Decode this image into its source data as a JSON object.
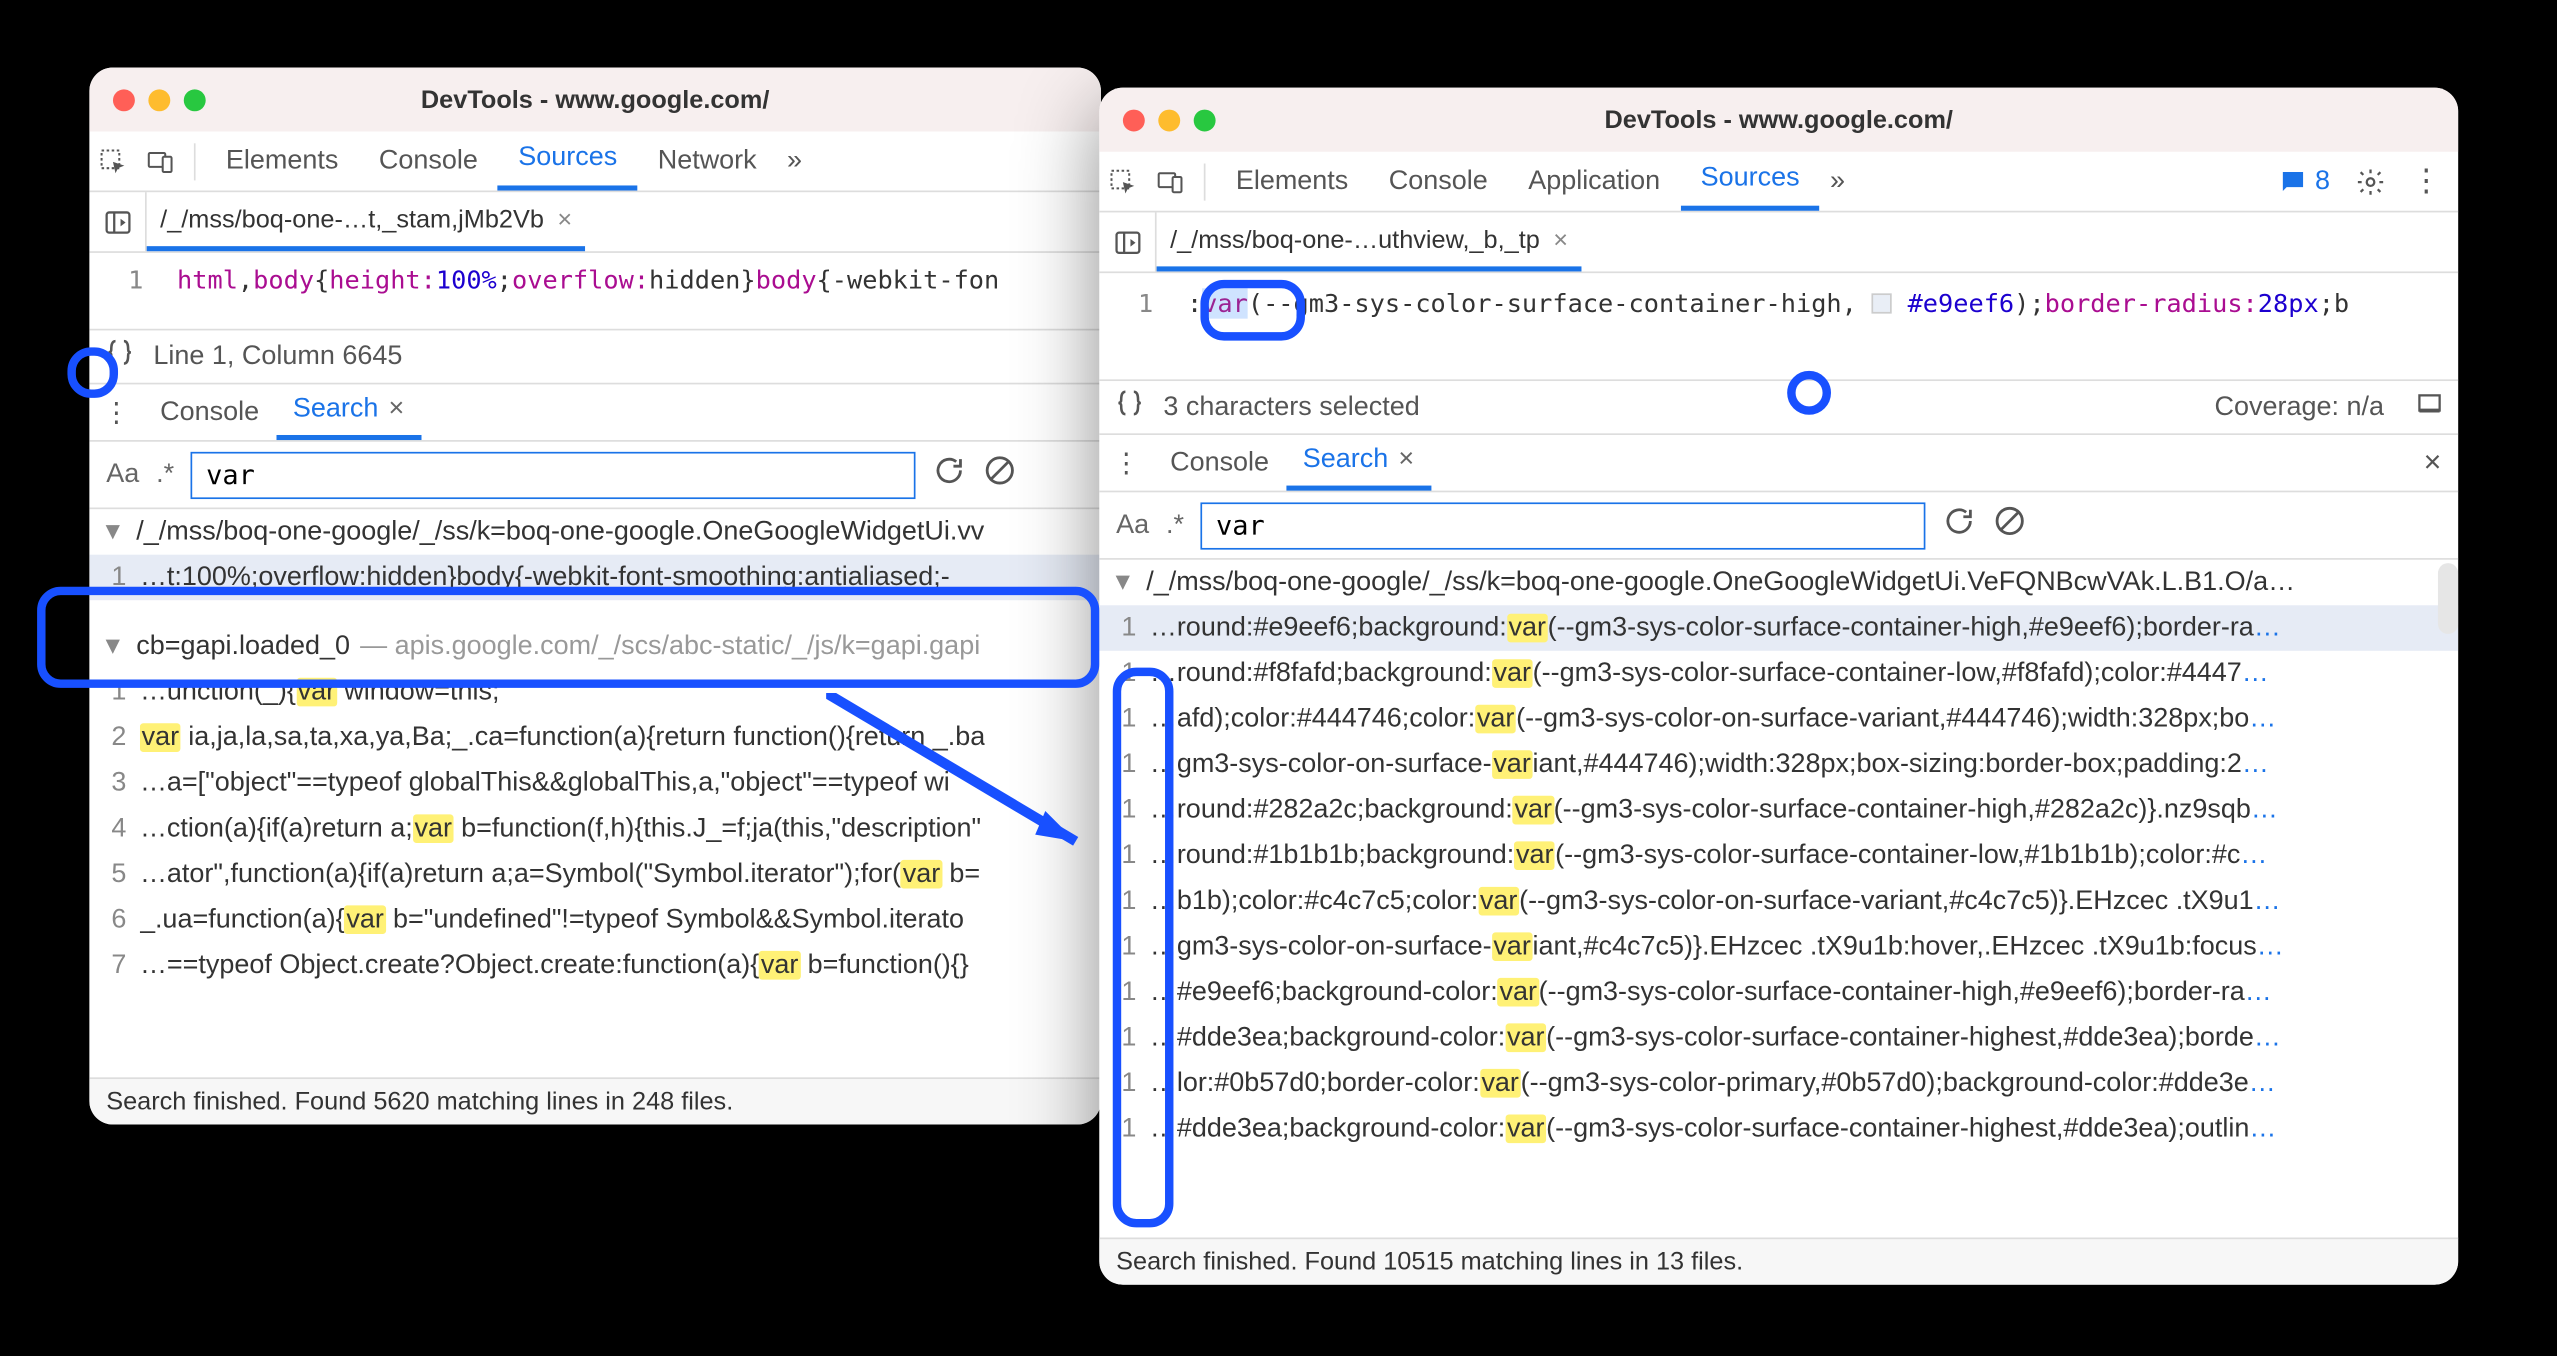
{
  "left": {
    "title": "DevTools - www.google.com/",
    "tabs": [
      "Elements",
      "Console",
      "Sources",
      "Network"
    ],
    "tabs_active": "Sources",
    "more": "»",
    "file_tab": "/_/mss/boq-one-…t,_stam,jMb2Vb",
    "code_line_no": "1",
    "code_html_pre": "html",
    "code_html_comma": ",",
    "code_body": "body",
    "code_ob": "{",
    "code_height_prop": "height:",
    "code_100": "100%",
    "code_sc": ";",
    "code_overflow_prop": "overflow:",
    "code_hidden": "hidden",
    "code_cb": "}",
    "code_body2": "body",
    "code_ob2": "{",
    "code_webkitfon": "-webkit-fon",
    "status": "Line 1, Column 6645",
    "drawer_tabs": {
      "console": "Console",
      "search": "Search"
    },
    "search_value": "var",
    "file1_path": "/_/mss/boq-one-google/_/ss/k=boq-one-google.OneGoogleWidgetUi.vv",
    "file1_rows": [
      {
        "ln": "1",
        "pre": "…t:100%;overflow:hidden}body{-webkit-font-smoothing:antialiased;-"
      }
    ],
    "file2_name": "cb=gapi.loaded_0",
    "file2_dim": " — apis.google.com/_/scs/abc-static/_/js/k=gapi.gapi",
    "file2_rows": [
      {
        "ln": "1",
        "pre": "…unction(_){",
        "hl": "var",
        "post": " window=this;"
      },
      {
        "ln": "2",
        "pre": "",
        "hl": "var",
        "post": " ia,ja,la,sa,ta,xa,ya,Ba;_.ca=function(a){return function(){return _.ba"
      },
      {
        "ln": "3",
        "pre": "…a=[\"object\"==typeof globalThis&&globalThis,a,\"object\"==typeof wi",
        "hl": "",
        "post": ""
      },
      {
        "ln": "4",
        "pre": "…ction(a){if(a)return a;",
        "hl": "var",
        "post": " b=function(f,h){this.J_=f;ja(this,\"description\""
      },
      {
        "ln": "5",
        "pre": "…ator\",function(a){if(a)return a;a=Symbol(\"Symbol.iterator\");for(",
        "hl": "var",
        "post": " b="
      },
      {
        "ln": "6",
        "pre": "_.ua=function(a){",
        "hl": "var",
        "post": " b=\"undefined\"!=typeof Symbol&&Symbol.iterato"
      },
      {
        "ln": "7",
        "pre": "…==typeof Object.create?Object.create:function(a){",
        "hl": "var",
        "post": " b=function(){}"
      }
    ],
    "footer": "Search finished.  Found 5620 matching lines in 248 files."
  },
  "right": {
    "title": "DevTools - www.google.com/",
    "tabs": [
      "Elements",
      "Console",
      "Application",
      "Sources"
    ],
    "tabs_active": "Sources",
    "more": "»",
    "msg_count": "8",
    "file_tab": "/_/mss/boq-one-…uthview,_b,_tp",
    "code_line_no": "1",
    "code_colon": ":",
    "code_var": "var",
    "code_paren": "(",
    "code_custom": "--gm3-sys-color-surface-container-high",
    "code_comma": ", ",
    "code_hex": "#e9eef6",
    "code_cp": ");",
    "code_br": "border-radius:",
    "code_28": "28px",
    "code_sc": ";",
    "code_b": "b",
    "status": "3 characters selected",
    "coverage": "Coverage: n/a",
    "drawer_tabs": {
      "console": "Console",
      "search": "Search"
    },
    "search_value": "var",
    "file1_path": "/_/mss/boq-one-google/_/ss/k=boq-one-google.OneGoogleWidgetUi.VeFQNBcwVAk.L.B1.O/a…",
    "rows": [
      {
        "ln": "1",
        "pre": ".round:#e9eef6;background:",
        "hl": "var",
        "post": "(--gm3-sys-color-surface-container-high,#e9eef6);border-ra",
        "sel": true
      },
      {
        "ln": "1",
        "pre": ".round:#f8fafd;background:",
        "hl": "var",
        "post": "(--gm3-sys-color-surface-container-low,#f8fafd);color:#4447"
      },
      {
        "ln": "1",
        "pre": ".afd);color:#444746;color:",
        "hl": "var",
        "post": "(--gm3-sys-color-on-surface-variant,#444746);width:328px;bo"
      },
      {
        "ln": "1",
        "pre": ".gm3-sys-color-on-surface-",
        "hl": "var",
        "post": "iant,#444746);width:328px;box-sizing:border-box;padding:2"
      },
      {
        "ln": "1",
        "pre": ".round:#282a2c;background:",
        "hl": "var",
        "post": "(--gm3-sys-color-surface-container-high,#282a2c)}.nz9sqb"
      },
      {
        "ln": "1",
        "pre": ".round:#1b1b1b;background:",
        "hl": "var",
        "post": "(--gm3-sys-color-surface-container-low,#1b1b1b);color:#c"
      },
      {
        "ln": "1",
        "pre": ".b1b);color:#c4c7c5;color:",
        "hl": "var",
        "post": "(--gm3-sys-color-on-surface-variant,#c4c7c5)}.EHzcec .tX9u1"
      },
      {
        "ln": "1",
        "pre": ".gm3-sys-color-on-surface-",
        "hl": "var",
        "post": "iant,#c4c7c5)}.EHzcec .tX9u1b:hover,.EHzcec .tX9u1b:focus"
      },
      {
        "ln": "1",
        "pre": ".#e9eef6;background-color:",
        "hl": "var",
        "post": "(--gm3-sys-color-surface-container-high,#e9eef6);border-ra"
      },
      {
        "ln": "1",
        "pre": ".#dde3ea;background-color:",
        "hl": "var",
        "post": "(--gm3-sys-color-surface-container-highest,#dde3ea);borde"
      },
      {
        "ln": "1",
        "pre": ".lor:#0b57d0;border-color:",
        "hl": "var",
        "post": "(--gm3-sys-color-primary,#0b57d0);background-color:#dde3e"
      },
      {
        "ln": "1",
        "pre": ".#dde3ea;background-color:",
        "hl": "var",
        "post": "(--gm3-sys-color-surface-container-highest,#dde3ea);outlin"
      }
    ],
    "footer": "Search finished.  Found 10515 matching lines in 13 files."
  },
  "aa_label": "Aa",
  "regex_label": ".*"
}
